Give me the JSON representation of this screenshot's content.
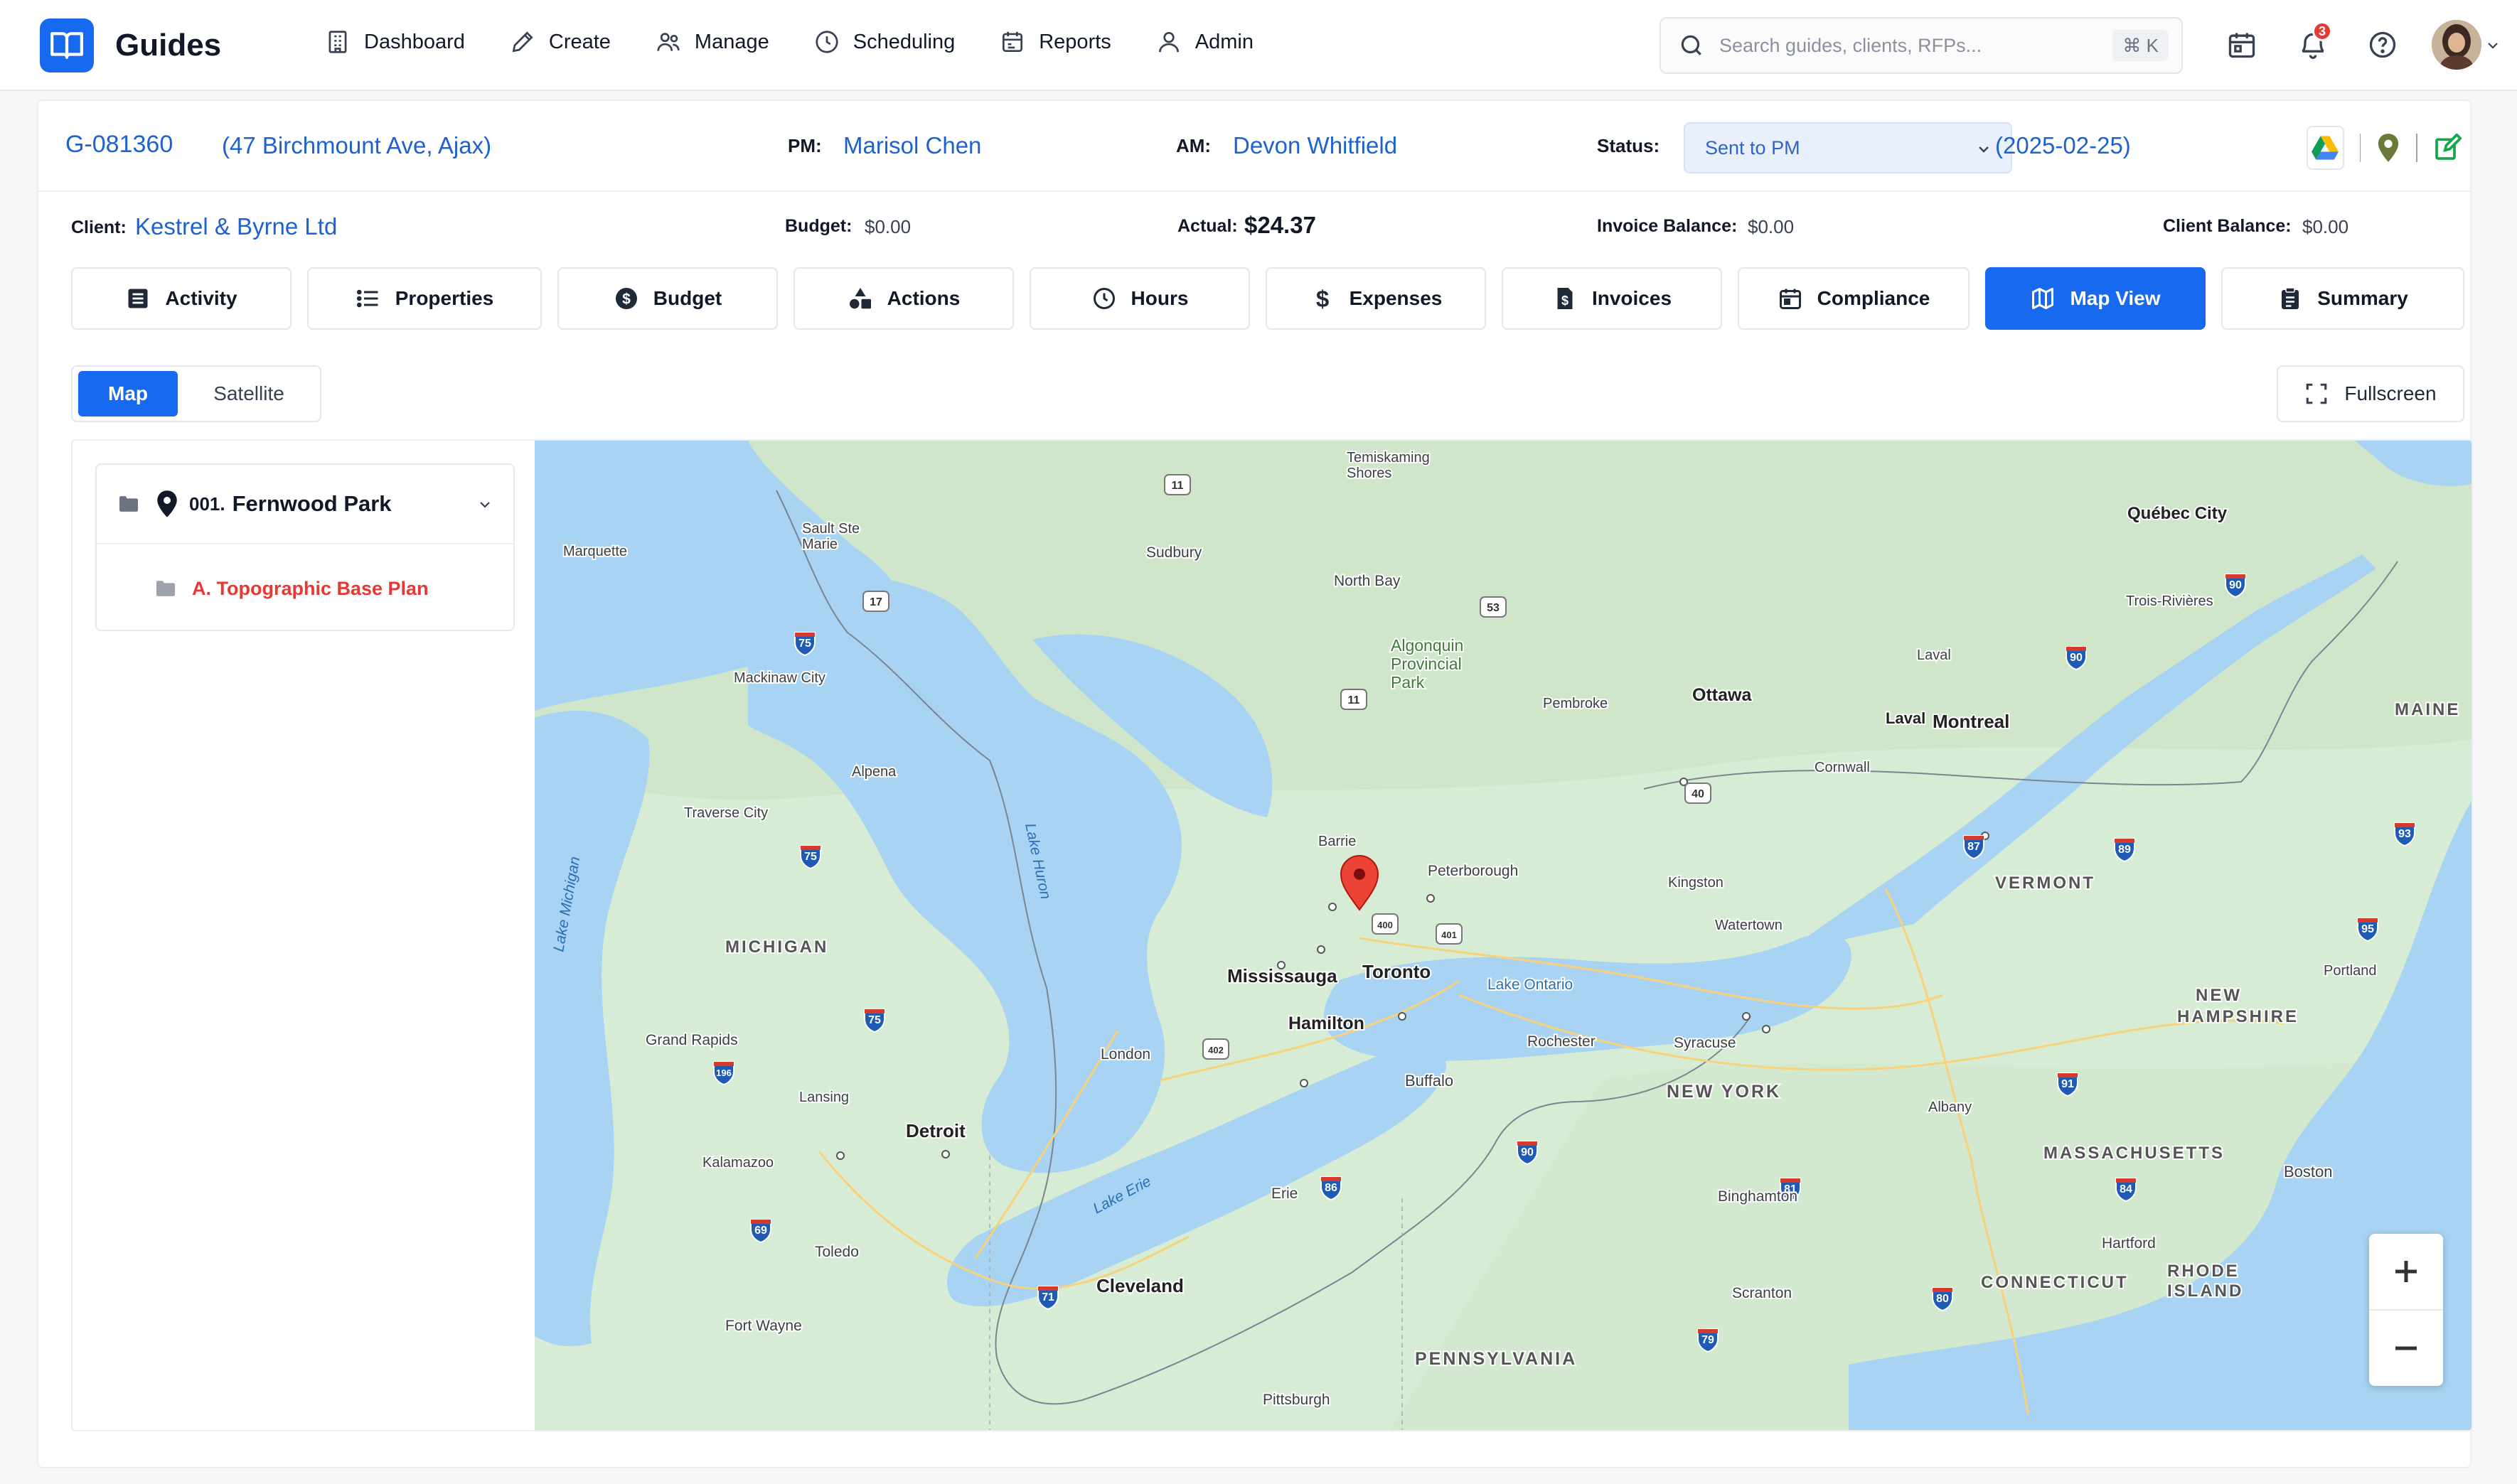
{
  "app": {
    "name": "Guides"
  },
  "nav": {
    "items": [
      {
        "label": "Dashboard",
        "icon": "building-icon"
      },
      {
        "label": "Create",
        "icon": "pencil-icon"
      },
      {
        "label": "Manage",
        "icon": "users-icon"
      },
      {
        "label": "Scheduling",
        "icon": "clock-icon"
      },
      {
        "label": "Reports",
        "icon": "report-icon"
      },
      {
        "label": "Admin",
        "icon": "user-icon"
      }
    ],
    "search_placeholder": "Search guides, clients, RFPs...",
    "shortcut": "⌘ K",
    "notifications_count": "3"
  },
  "job": {
    "id": "G-081360",
    "address": "(47 Birchmount Ave, Ajax)",
    "pm_label": "PM:",
    "pm": "Marisol Chen",
    "am_label": "AM:",
    "am": "Devon Whitfield",
    "status_label": "Status:",
    "status": "Sent to PM",
    "date": "(2025-02-25)",
    "client_label": "Client:",
    "client": "Kestrel & Byrne Ltd",
    "budget_label": "Budget:",
    "budget": "$0.00",
    "actual_label": "Actual:",
    "actual": "$24.37",
    "invoice_balance_label": "Invoice Balance:",
    "invoice_balance": "$0.00",
    "client_balance_label": "Client Balance:",
    "client_balance": "$0.00"
  },
  "tabs": [
    {
      "label": "Activity"
    },
    {
      "label": "Properties"
    },
    {
      "label": "Budget"
    },
    {
      "label": "Actions"
    },
    {
      "label": "Hours"
    },
    {
      "label": "Expenses"
    },
    {
      "label": "Invoices"
    },
    {
      "label": "Compliance"
    },
    {
      "label": "Map View",
      "active": true
    },
    {
      "label": "Summary"
    }
  ],
  "map_toggle": {
    "map": "Map",
    "satellite": "Satellite",
    "fullscreen": "Fullscreen"
  },
  "tree": {
    "property_num": "001.",
    "property_name": "Fernwood Park",
    "child": "A. Topographic Base Plan"
  },
  "map": {
    "labels": {
      "temiskaming": "Temiskaming",
      "shores": "Shores",
      "sault": "Sault Ste",
      "marie": "Marie",
      "marquette": "Marquette",
      "sudbury": "Sudbury",
      "north_bay": "North Bay",
      "algonquin": "Algonquin",
      "provincial": "Provincial",
      "park": "Park",
      "mackinaw": "Mackinaw City",
      "alpena": "Alpena",
      "traverse": "Traverse City",
      "lake_michigan": "Lake Michigan",
      "lake_huron": "Lake Huron",
      "michigan": "MICHIGAN",
      "barrie": "Barrie",
      "peterborough": "Peterborough",
      "pembroke": "Pembroke",
      "ottawa": "Ottawa",
      "quebec": "Québec City",
      "trois": "Trois-Rivières",
      "laval_small": "Laval",
      "laval": "Laval",
      "montreal": "Montreal",
      "cornwall": "Cornwall",
      "maine": "MAINE",
      "vermont": "VERMONT",
      "kingston": "Kingston",
      "watertown": "Watertown",
      "mississauga": "Mississauga",
      "toronto": "Toronto",
      "hamilton": "Hamilton",
      "lake_ontario": "Lake Ontario",
      "portland": "Portland",
      "new": "NEW",
      "hampshire": "HAMPSHIRE",
      "grand_rapids": "Grand Rapids",
      "london": "London",
      "rochester": "Rochester",
      "syracuse": "Syracuse",
      "buffalo": "Buffalo",
      "lansing": "Lansing",
      "new_york": "NEW YORK",
      "albany": "Albany",
      "detroit": "Detroit",
      "kalamazoo": "Kalamazoo",
      "massachusetts": "MASSACHUSETTS",
      "boston": "Boston",
      "lake_erie": "Lake Erie",
      "erie": "Erie",
      "binghamton": "Binghamton",
      "toledo": "Toledo",
      "cleveland": "Cleveland",
      "hartford": "Hartford",
      "rhode": "RHODE",
      "island": "ISLAND",
      "connecticut": "CONNECTICUT",
      "scranton": "Scranton",
      "fort_wayne": "Fort Wayne",
      "pennsylvania": "PENNSYLVANIA",
      "pittsburgh": "Pittsburgh"
    },
    "shields": {
      "h11a": "11",
      "h11b": "11",
      "h53": "53",
      "h17": "17",
      "i75a": "75",
      "i75b": "75",
      "i75c": "75",
      "h400": "400",
      "h401": "401",
      "h402": "402",
      "h40": "40",
      "i90a": "90",
      "i90b": "90",
      "i90c": "90",
      "i87": "87",
      "i89": "89",
      "i91": "91",
      "i93": "93",
      "i95": "95",
      "i196": "196",
      "i69": "69",
      "i81": "81",
      "i80": "80",
      "i79": "79",
      "i71": "71",
      "i86": "86",
      "i84": "84"
    },
    "colors": {
      "land": "#d7ecd4",
      "water": "#a9d3f2",
      "marker": "#ea4335"
    }
  }
}
